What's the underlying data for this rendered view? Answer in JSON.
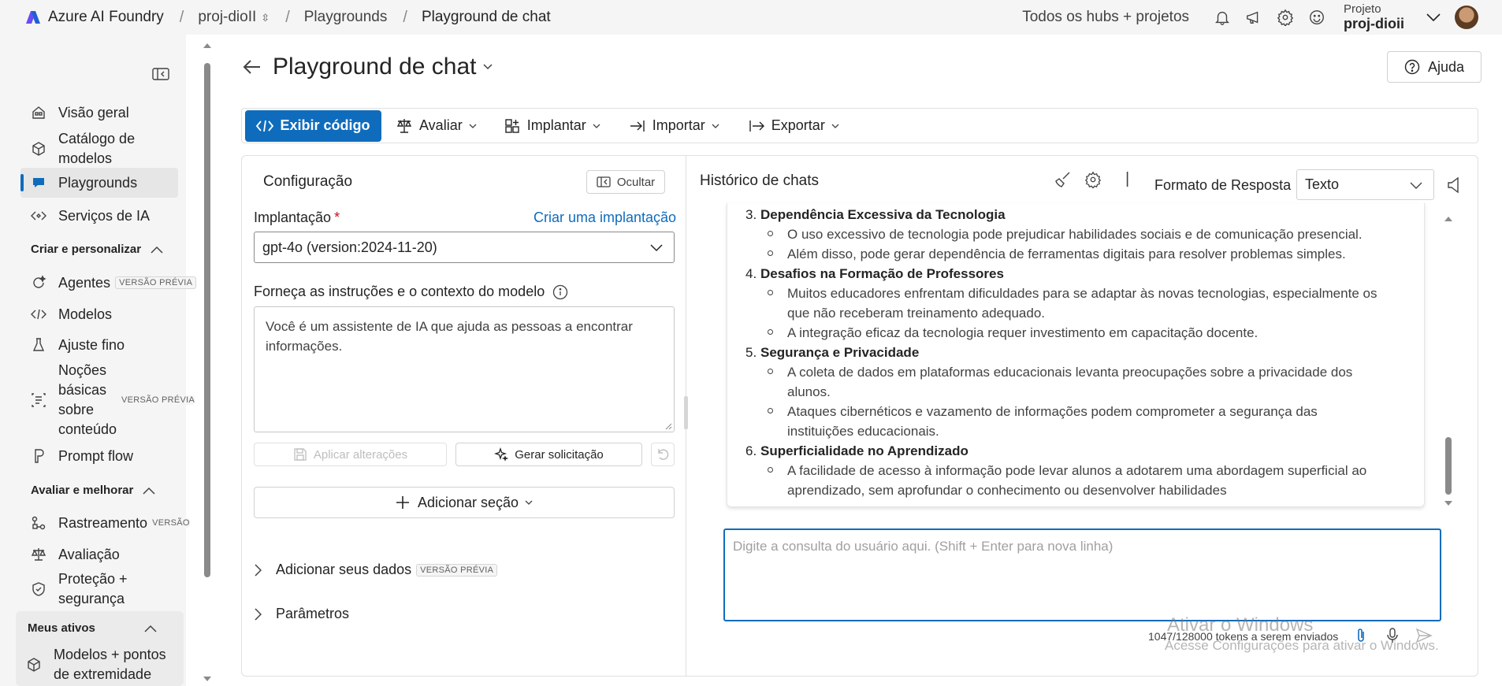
{
  "topbar": {
    "brand": "Azure AI Foundry",
    "breadcrumbs": [
      "proj-dioII",
      "Playgrounds",
      "Playground de chat"
    ],
    "hubs_link": "Todos os hubs + projetos",
    "project_label": "Projeto",
    "project_name": "proj-dioii"
  },
  "sidebar": {
    "items": [
      {
        "label": "Visão geral",
        "icon": "home-icon"
      },
      {
        "label": "Catálogo de modelos",
        "icon": "cube-icon"
      },
      {
        "label": "Playgrounds",
        "icon": "chat-icon",
        "active": true
      },
      {
        "label": "Serviços de IA",
        "icon": "code-diamond-icon"
      }
    ],
    "section1": "Criar e personalizar",
    "items2": [
      {
        "label": "Agentes",
        "badge": "VERSÃO PRÉVIA"
      },
      {
        "label": "Modelos"
      },
      {
        "label": "Ajuste fino"
      },
      {
        "label": "Noções básicas sobre conteúdo",
        "badge": "VERSÃO PRÉVIA"
      },
      {
        "label": "Prompt flow"
      }
    ],
    "section2": "Avaliar e melhorar",
    "items3": [
      {
        "label": "Rastreamento",
        "badge": "VERSÃO"
      },
      {
        "label": "Avaliação"
      },
      {
        "label": "Proteção + segurança"
      }
    ],
    "section3": "Meus ativos",
    "items4": [
      {
        "label": "Modelos + pontos de extremidade"
      }
    ]
  },
  "page": {
    "title": "Playground de chat",
    "help": "Ajuda"
  },
  "toolbar": {
    "view_code": "Exibir código",
    "evaluate": "Avaliar",
    "deploy": "Implantar",
    "import": "Importar",
    "export": "Exportar"
  },
  "config": {
    "title": "Configuração",
    "hide": "Ocultar",
    "deployment_label": "Implantação",
    "required": "*",
    "create_link": "Criar uma implantação",
    "deployment_value": "gpt-4o (version:2024-11-20)",
    "instructions_label": "Forneça as instruções e o contexto do modelo",
    "instructions_value": "Você é um assistente de IA que ajuda as pessoas a encontrar informações.",
    "apply": "Aplicar alterações",
    "generate": "Gerar solicitação",
    "add_section": "Adicionar seção",
    "add_data": "Adicionar seus dados",
    "add_data_badge": "VERSÃO PRÉVIA",
    "parameters": "Parâmetros"
  },
  "history": {
    "title": "Histórico de chats",
    "sep": "|",
    "format_label": "Formato de Resposta",
    "format_value": "Texto",
    "items": [
      {
        "n": "3.",
        "head": "Dependência Excessiva da Tecnologia",
        "bullets": [
          "O uso excessivo de tecnologia pode prejudicar habilidades sociais e de comunicação presencial.",
          "Além disso, pode gerar dependência de ferramentas digitais para resolver problemas simples."
        ]
      },
      {
        "n": "4.",
        "head": "Desafios na Formação de Professores",
        "bullets": [
          "Muitos educadores enfrentam dificuldades para se adaptar às novas tecnologias, especialmente os",
          "que não receberam treinamento adequado.",
          "A integração eficaz da tecnologia requer investimento em capacitação docente."
        ]
      },
      {
        "n": "5.",
        "head": "Segurança e Privacidade",
        "bullets": [
          "A coleta de dados em plataformas educacionais levanta preocupações sobre a privacidade dos",
          "alunos.",
          "Ataques cibernéticos e vazamento de informações podem comprometer a segurança das",
          "instituições educacionais."
        ]
      },
      {
        "n": "6.",
        "head": "Superficialidade no Aprendizado",
        "bullets": [
          "A facilidade de acesso à informação pode levar alunos a adotarem uma abordagem superficial ao",
          "aprendizado, sem aprofundar o conhecimento ou desenvolver habilidades"
        ]
      }
    ],
    "query_placeholder": "Digite a consulta do usuário aqui. (Shift + Enter para nova linha)",
    "tokens": "1047/128000 tokens a serem enviados"
  },
  "watermark": {
    "line1": "Ativar o Windows",
    "line2": "Acesse Configurações para ativar o Windows."
  }
}
